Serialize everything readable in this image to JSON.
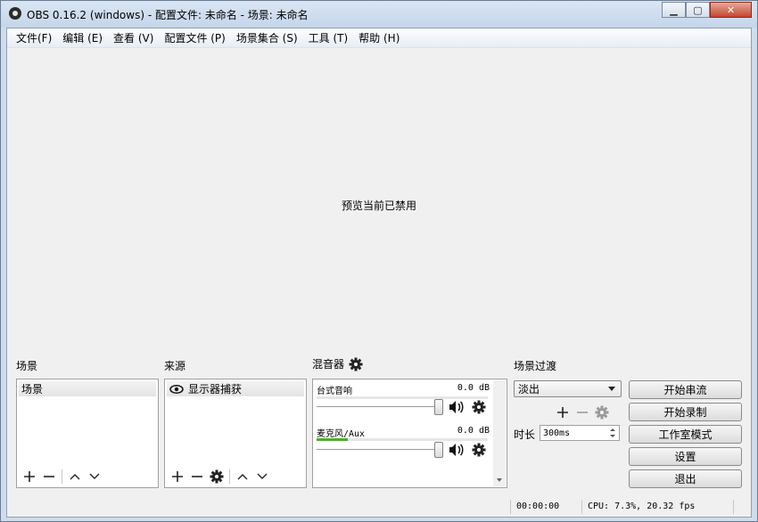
{
  "window": {
    "title": "OBS 0.16.2 (windows) - 配置文件: 未命名 - 场景: 未命名",
    "minimize_glyph": "▁",
    "maximize_glyph": "▢",
    "close_glyph": "✕"
  },
  "menu": {
    "items": [
      {
        "label": "文件(F)"
      },
      {
        "label": "编辑 (E)"
      },
      {
        "label": "查看 (V)"
      },
      {
        "label": "配置文件 (P)"
      },
      {
        "label": "场景集合 (S)"
      },
      {
        "label": "工具 (T)"
      },
      {
        "label": "帮助 (H)"
      }
    ]
  },
  "preview": {
    "message": "预览当前已禁用"
  },
  "scenes": {
    "title": "场景",
    "items": [
      "场景"
    ]
  },
  "sources": {
    "title": "来源",
    "items": [
      "显示器捕获"
    ]
  },
  "mixer": {
    "title": "混音器",
    "channels": [
      {
        "name": "台式音响",
        "db": "0.0 dB",
        "level": 0.0,
        "volume": 1.0
      },
      {
        "name": "麦克风/Aux",
        "db": "0.0 dB",
        "level": 0.18,
        "volume": 1.0
      }
    ]
  },
  "transitions": {
    "title": "场景过渡",
    "selected": "淡出",
    "duration_label": "时长",
    "duration_value": "300ms"
  },
  "controls": {
    "start_stream": "开始串流",
    "start_record": "开始录制",
    "studio_mode": "工作室模式",
    "settings": "设置",
    "exit": "退出"
  },
  "status": {
    "time": "00:00:00",
    "cpu": "CPU: 7.3%, 20.32 fps"
  },
  "colors": {
    "meter_green": "#4caf2a",
    "close_red": "#c4452d"
  }
}
